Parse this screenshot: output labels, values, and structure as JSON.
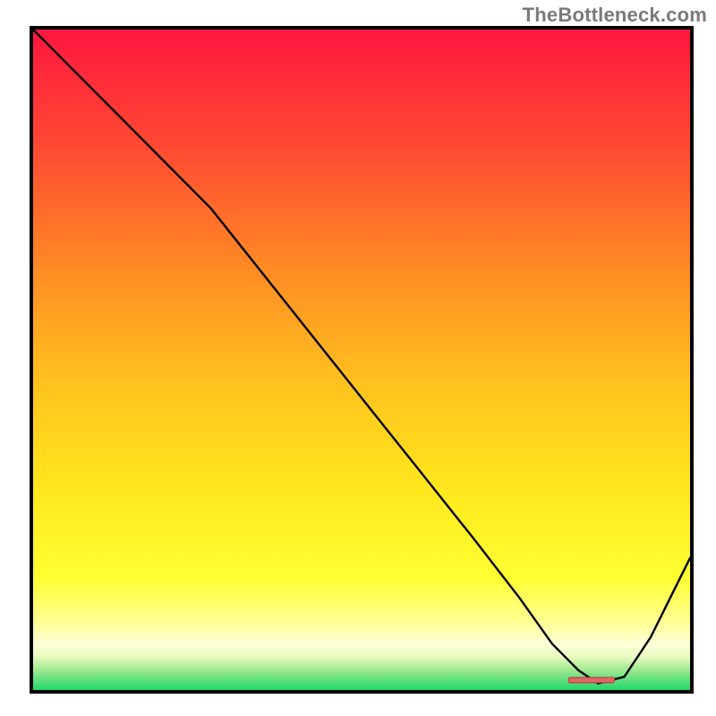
{
  "watermark": "TheBottleneck.com",
  "chart_data": {
    "type": "line",
    "title": "",
    "xlabel": "",
    "ylabel": "",
    "xlim": [
      0,
      100
    ],
    "ylim": [
      0,
      100
    ],
    "grid": false,
    "background_gradient": {
      "top_hex": "#ff173f",
      "upper_mid_hex": "#ff6b2e",
      "mid_hex": "#ffd21e",
      "lower_yellow_hex": "#ffff32",
      "pale_yellow_hex": "#ffffbe",
      "near_bottom_hex": "#d6f5a0",
      "bottom_hex": "#1fd86b"
    },
    "series": [
      {
        "name": "bottleneck-curve",
        "x": [
          0,
          10,
          20,
          27,
          35,
          43,
          51,
          59,
          67,
          74,
          79,
          83,
          86,
          90,
          94,
          100
        ],
        "y": [
          100,
          90,
          80,
          73,
          63,
          53,
          43,
          33,
          23,
          14,
          7,
          3,
          1,
          2,
          8,
          20
        ]
      }
    ],
    "marker": {
      "name": "optimum-band",
      "x_start": 81.5,
      "x_end": 88.5,
      "y": 1.5,
      "color_hex": "#e06666"
    }
  }
}
